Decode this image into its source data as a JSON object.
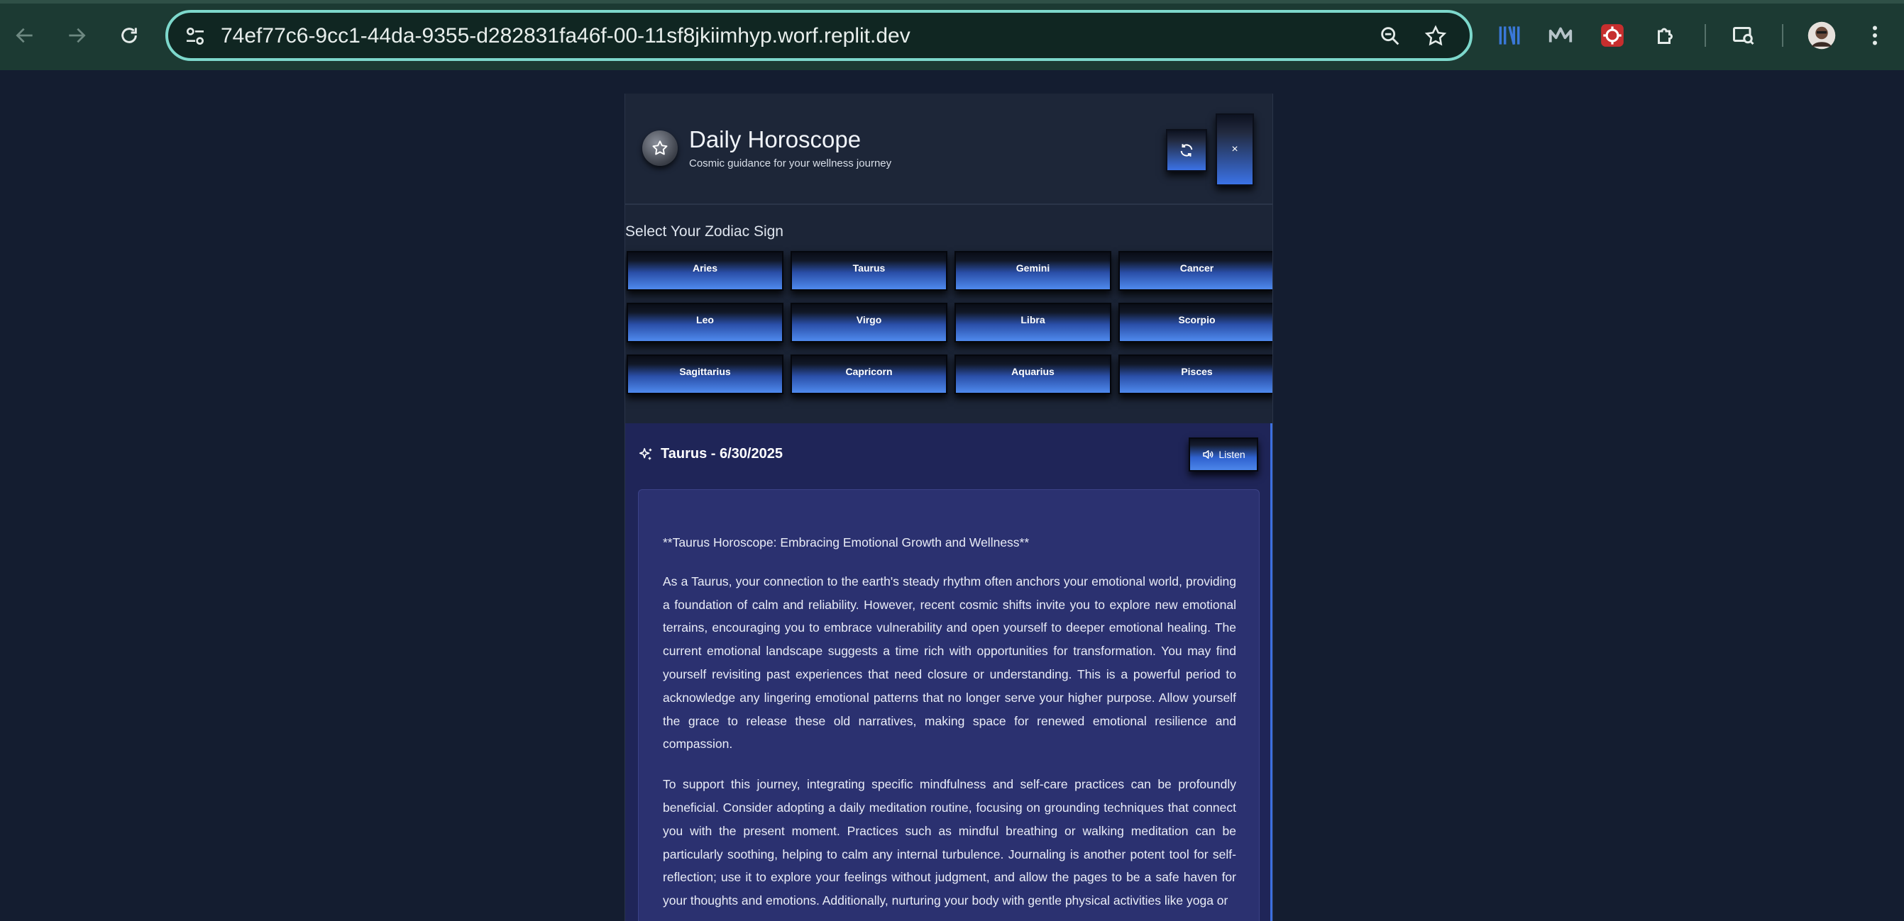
{
  "browser": {
    "url": "74ef77c6-9cc1-44da-9355-d282831fa46f-00-11sf8jkiimhyp.worf.replit.dev"
  },
  "header": {
    "title": "Daily Horoscope",
    "subtitle": "Cosmic guidance for your wellness journey",
    "close_label": "×"
  },
  "zodiac": {
    "label": "Select Your Zodiac Sign",
    "signs": [
      "Aries",
      "Taurus",
      "Gemini",
      "Cancer",
      "Leo",
      "Virgo",
      "Libra",
      "Scorpio",
      "Sagittarius",
      "Capricorn",
      "Aquarius",
      "Pisces"
    ],
    "selected": "Taurus"
  },
  "result": {
    "title": "Taurus - 6/30/2025",
    "listen_label": "Listen",
    "headline": "**Taurus Horoscope: Embracing Emotional Growth and Wellness**",
    "paragraphs": [
      "As a Taurus, your connection to the earth's steady rhythm often anchors your emotional world, providing a foundation of calm and reliability. However, recent cosmic shifts invite you to explore new emotional terrains, encouraging you to embrace vulnerability and open yourself to deeper emotional healing. The current emotional landscape suggests a time rich with opportunities for transformation. You may find yourself revisiting past experiences that need closure or understanding. This is a powerful period to acknowledge any lingering emotional patterns that no longer serve your higher purpose. Allow yourself the grace to release these old narratives, making space for renewed emotional resilience and compassion.",
      "To support this journey, integrating specific mindfulness and self-care practices can be profoundly beneficial. Consider adopting a daily meditation routine, focusing on grounding techniques that connect you with the present moment. Practices such as mindful breathing or walking meditation can be particularly soothing, helping to calm any internal turbulence. Journaling is another potent tool for self-reflection; use it to explore your feelings without judgment, and allow the pages to be a safe haven for your thoughts and emotions. Additionally, nurturing your body with gentle physical activities like yoga or"
    ]
  },
  "colors": {
    "accent": "#3c6fe0",
    "page_bg": "#141d30",
    "result_bg": "#1f2558"
  }
}
